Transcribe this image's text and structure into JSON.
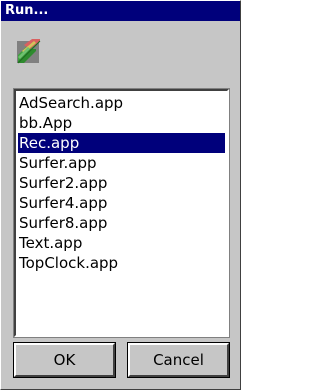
{
  "window": {
    "title": "Run..."
  },
  "icon": {
    "name": "run-app-icon"
  },
  "list": {
    "items": [
      "AdSearch.app",
      "bb.App",
      "Rec.app",
      "Surfer.app",
      "Surfer2.app",
      "Surfer4.app",
      "Surfer8.app",
      "Text.app",
      "TopClock.app"
    ],
    "selected_index": 2
  },
  "buttons": {
    "ok_label": "OK",
    "cancel_label": "Cancel"
  },
  "colors": {
    "titlebar": "#00007b",
    "selection": "#00007b",
    "face": "#c6c6c6"
  }
}
